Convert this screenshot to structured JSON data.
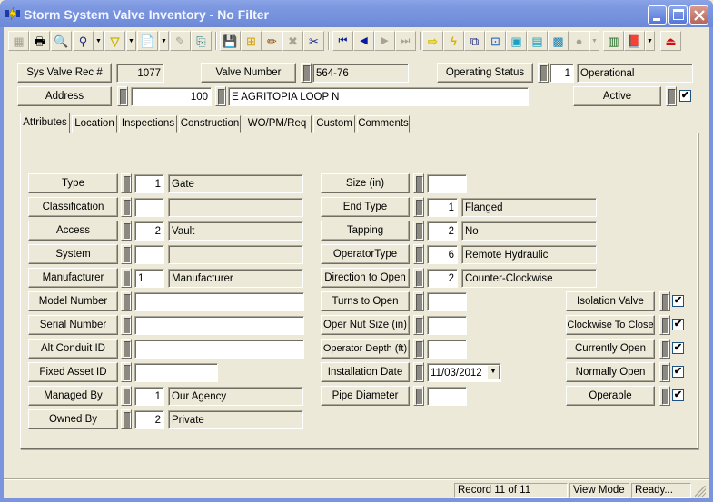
{
  "window": {
    "title": "Storm System Valve Inventory - No Filter",
    "controls": {
      "minimize": "_",
      "maximize": "□",
      "close": "✕"
    }
  },
  "toolbar": {
    "buttons": [
      {
        "name": "form-view-icon",
        "glyph": "▦",
        "enabled": false
      },
      {
        "name": "print-icon",
        "glyph": "🖶",
        "enabled": true
      },
      {
        "name": "print-preview-icon",
        "glyph": "🔍",
        "enabled": true
      },
      {
        "name": "find-icon",
        "glyph": "⚲",
        "enabled": true
      },
      {
        "name": "filter-icon",
        "glyph": "▽",
        "enabled": true
      },
      {
        "name": "report-icon",
        "glyph": "📄",
        "enabled": true
      },
      {
        "name": "edit-form-icon",
        "glyph": "✎",
        "enabled": false
      },
      {
        "name": "export-icon",
        "glyph": "⎘",
        "enabled": true
      },
      {
        "name": "save-icon",
        "glyph": "💾",
        "enabled": false
      },
      {
        "name": "add-record-icon",
        "glyph": "⊞",
        "enabled": true
      },
      {
        "name": "edit-pencil-icon",
        "glyph": "✏",
        "enabled": true
      },
      {
        "name": "delete-icon",
        "glyph": "✖",
        "enabled": false
      },
      {
        "name": "cut-icon",
        "glyph": "✂",
        "enabled": true
      },
      {
        "name": "first-record-icon",
        "glyph": "⏮",
        "enabled": true
      },
      {
        "name": "previous-record-icon",
        "glyph": "◀",
        "enabled": true
      },
      {
        "name": "next-record-icon",
        "glyph": "▶",
        "enabled": false
      },
      {
        "name": "last-record-icon",
        "glyph": "⏭",
        "enabled": false
      },
      {
        "name": "goto-icon",
        "glyph": "⇨",
        "enabled": true
      },
      {
        "name": "lightning-icon",
        "glyph": "ϟ",
        "enabled": true
      },
      {
        "name": "hierarchy-icon",
        "glyph": "⧉",
        "enabled": true
      },
      {
        "name": "connect-icon",
        "glyph": "⊡",
        "enabled": true
      },
      {
        "name": "equipment-icon",
        "glyph": "▣",
        "enabled": true
      },
      {
        "name": "calculator-icon",
        "glyph": "▤",
        "enabled": true
      },
      {
        "name": "map-icon",
        "glyph": "▩",
        "enabled": true
      },
      {
        "name": "chat-icon",
        "glyph": "●",
        "enabled": false
      },
      {
        "name": "spreadsheet-icon",
        "glyph": "▥",
        "enabled": true
      },
      {
        "name": "help-book-icon",
        "glyph": "📕",
        "enabled": true
      },
      {
        "name": "exit-icon",
        "glyph": "⏏",
        "enabled": true
      }
    ]
  },
  "header": {
    "sys_valve_rec_label": "Sys Valve Rec #",
    "sys_valve_rec_value": "1077",
    "valve_number_label": "Valve Number",
    "valve_number_value": "564-76",
    "operating_status_label": "Operating Status",
    "operating_status_code": "1",
    "operating_status_value": "Operational",
    "address_label": "Address",
    "address_number": "100",
    "address_street": "E AGRITOPIA LOOP N",
    "active_label": "Active",
    "active_checked": true
  },
  "tabs": [
    {
      "label": "Attributes",
      "active": true
    },
    {
      "label": "Location",
      "active": false
    },
    {
      "label": "Inspections",
      "active": false
    },
    {
      "label": "Construction",
      "active": false
    },
    {
      "label": "WO/PM/Req",
      "active": false
    },
    {
      "label": "Custom",
      "active": false
    },
    {
      "label": "Comments",
      "active": false
    }
  ],
  "attributes": {
    "left": [
      {
        "label": "Type",
        "code": "1",
        "value": "Gate"
      },
      {
        "label": "Classification",
        "code": "",
        "value": ""
      },
      {
        "label": "Access",
        "code": "2",
        "value": "Vault"
      },
      {
        "label": "System",
        "code": "",
        "value": ""
      },
      {
        "label": "Manufacturer",
        "code": "1",
        "value": "Manufacturer"
      },
      {
        "label": "Model Number",
        "value": ""
      },
      {
        "label": "Serial Number",
        "value": ""
      },
      {
        "label": "Alt Conduit ID",
        "value": ""
      },
      {
        "label": "Fixed Asset ID",
        "value": ""
      },
      {
        "label": "Managed By",
        "code": "1",
        "value": "Our Agency"
      },
      {
        "label": "Owned By",
        "code": "2",
        "value": "Private"
      }
    ],
    "middle": [
      {
        "label": "Size (in)",
        "value": ""
      },
      {
        "label": "End Type",
        "code": "1",
        "value": "Flanged"
      },
      {
        "label": "Tapping",
        "code": "2",
        "value": "No"
      },
      {
        "label": "OperatorType",
        "code": "6",
        "value": "Remote Hydraulic"
      },
      {
        "label": "Direction to Open",
        "code": "2",
        "value": "Counter-Clockwise"
      },
      {
        "label": "Turns to Open",
        "value": ""
      },
      {
        "label": "Oper Nut Size (in)",
        "value": ""
      },
      {
        "label": "Operator Depth (ft)",
        "value": ""
      },
      {
        "label": "Installation Date",
        "value": "11/03/2012"
      },
      {
        "label": "Pipe Diameter",
        "value": ""
      }
    ],
    "checks": [
      {
        "label": "Isolation Valve",
        "checked": true
      },
      {
        "label": "Clockwise To Close",
        "checked": true
      },
      {
        "label": "Currently Open",
        "checked": true
      },
      {
        "label": "Normally Open",
        "checked": true
      },
      {
        "label": "Operable",
        "checked": true
      }
    ]
  },
  "statusbar": {
    "record": "Record 11 of 11",
    "mode": "View Mode",
    "state": "Ready..."
  },
  "glyphs": {
    "check": "✔",
    "dropdown": "▼"
  }
}
